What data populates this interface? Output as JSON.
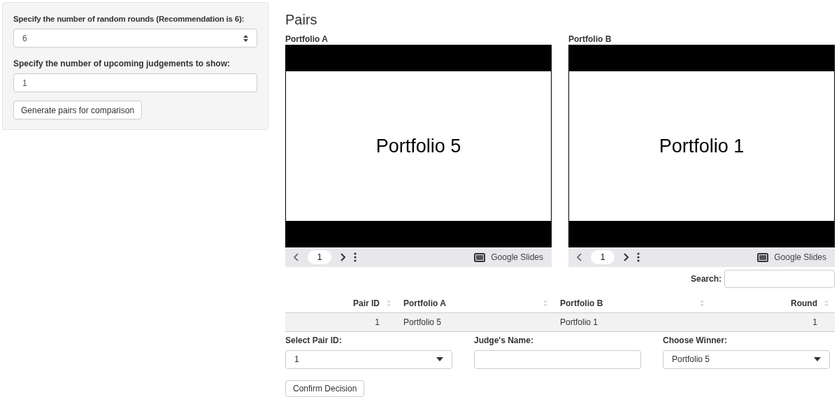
{
  "sidebar": {
    "rounds_label": "Specify the number of random rounds (Recommendation is 6):",
    "rounds_value": "6",
    "upcoming_label": "Specify the number of upcoming judgements to show:",
    "upcoming_value": "1",
    "generate_button": "Generate pairs for comparison"
  },
  "main": {
    "title": "Pairs",
    "slides": [
      {
        "label": "Portfolio A",
        "slide_text": "Portfolio 5",
        "page": "1",
        "brand": "Google Slides"
      },
      {
        "label": "Portfolio B",
        "slide_text": "Portfolio 1",
        "page": "1",
        "brand": "Google Slides"
      }
    ],
    "search_label": "Search:",
    "table": {
      "columns": [
        "Pair ID",
        "Portfolio A",
        "Portfolio B",
        "Round"
      ],
      "rows": [
        [
          "1",
          "Portfolio 5",
          "Portfolio 1",
          "1"
        ]
      ]
    },
    "pair_select": {
      "label": "Select Pair ID:",
      "value": "1"
    },
    "judge_name": {
      "label": "Judge's Name:"
    },
    "winner_select": {
      "label": "Choose Winner:",
      "value": "Portfolio 5"
    },
    "confirm_button": "Confirm Decision"
  }
}
